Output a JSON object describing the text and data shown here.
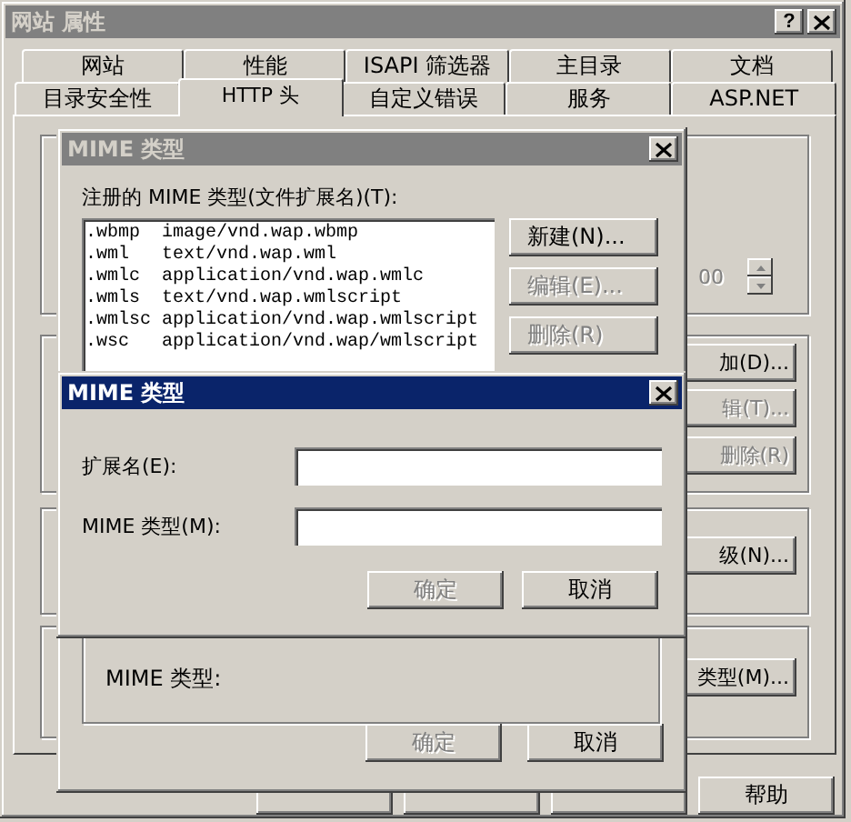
{
  "window": {
    "title": "网站 属性",
    "help_button": "?",
    "active": false
  },
  "tabs": [
    [
      {
        "label": "网站",
        "selected": false
      },
      {
        "label": "性能",
        "selected": false
      },
      {
        "label": "ISAPI 筛选器",
        "selected": false
      },
      {
        "label": "主目录",
        "selected": false
      },
      {
        "label": "文档",
        "selected": false
      }
    ],
    [
      {
        "label": "目录安全性",
        "selected": false
      },
      {
        "label": "HTTP 头",
        "selected": true
      },
      {
        "label": "自定义错误",
        "selected": false
      },
      {
        "label": "服务",
        "selected": false
      },
      {
        "label": "ASP.NET",
        "selected": false
      }
    ]
  ],
  "panel": {
    "spinner_value": "00",
    "spinner_disabled": true,
    "buttons": [
      {
        "label": "加(D)...",
        "disabled": false
      },
      {
        "label": "辑(T)...",
        "disabled": true
      },
      {
        "label": "删除(R)",
        "disabled": true
      },
      {
        "label": "级(N)...",
        "disabled": false
      },
      {
        "label": "类型(M)...",
        "disabled": false
      }
    ]
  },
  "bottom_buttons": [
    {
      "kind": "covered"
    },
    {
      "kind": "covered"
    },
    {
      "kind": "covered"
    },
    {
      "kind": "button",
      "label": "帮助"
    }
  ],
  "dialogs": [
    {
      "title": "MIME 类型",
      "active": false,
      "list_label": "注册的 MIME 类型(文件扩展名)(T):",
      "list": [
        {
          "ext": ".wbmp",
          "type": "image/vnd.wap.wbmp"
        },
        {
          "ext": ".wml",
          "type": "text/vnd.wap.wml"
        },
        {
          "ext": ".wmlc",
          "type": "application/vnd.wap.wmlc"
        },
        {
          "ext": ".wmls",
          "type": "text/vnd.wap.wmlscript"
        },
        {
          "ext": ".wmlsc",
          "type": "application/vnd.wap.wmlscript"
        },
        {
          "ext": ".wsc",
          "type": "application/vnd.wap/wmlscript"
        }
      ],
      "buttons": [
        {
          "label": "新建(N)...",
          "disabled": false
        },
        {
          "label": "编辑(E)...",
          "disabled": true
        },
        {
          "label": "删除(R)",
          "disabled": true
        }
      ],
      "group_label": "MIME 类型:",
      "footer_buttons": [
        {
          "label": "确定",
          "disabled": true
        },
        {
          "label": "取消",
          "disabled": false
        }
      ]
    },
    {
      "title": "MIME 类型",
      "active": true,
      "fields": [
        {
          "label": "扩展名(E):"
        },
        {
          "label": "MIME 类型(M):"
        }
      ],
      "footer_buttons": [
        {
          "label": "确定",
          "disabled": true
        },
        {
          "label": "取消",
          "disabled": false
        }
      ]
    }
  ]
}
